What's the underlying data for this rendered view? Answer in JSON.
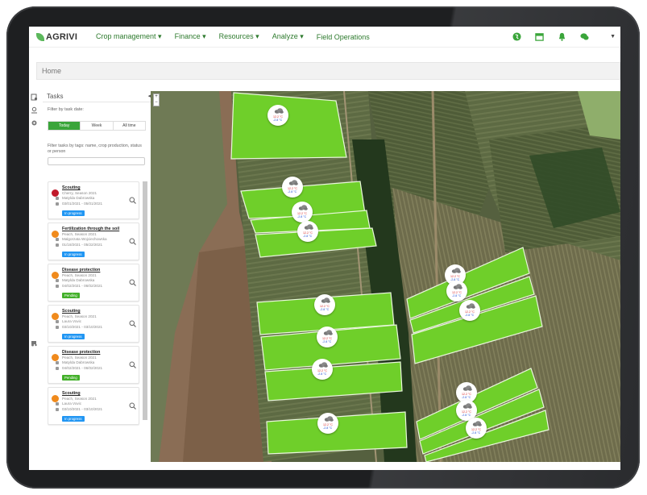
{
  "nav": {
    "logo": "AGRIVI",
    "items": [
      "Crop management",
      "Finance",
      "Resources",
      "Analyze",
      "Field Operations"
    ],
    "icons": [
      "globe-icon",
      "calendar-icon",
      "bell-icon",
      "chat-icon"
    ],
    "accent": "#2d7a2d"
  },
  "breadcrumb": {
    "home": "Home"
  },
  "tasks": {
    "title": "Tasks",
    "filter_date_label": "Filter by task date:",
    "segments": [
      "Today",
      "Week",
      "All time"
    ],
    "filter_tags_label": "Filter tasks by tags: name, crop production, status or person",
    "items": [
      {
        "title": "Scouting",
        "crop": "Cherry, Season 2021",
        "person": "Matylda Dabrowska",
        "dates": "03/01/2021 - 05/01/2021",
        "status": "In progress",
        "status_color": "#2196f3",
        "fruit_color": "#c0192a"
      },
      {
        "title": "Fertilization through the soil",
        "crop": "Peach, Season 2021",
        "person": "Malgorzata Wojciechowska",
        "dates": "01/18/2021 - 05/22/2021",
        "status": "In progress",
        "status_color": "#2196f3",
        "fruit_color": "#f08a1c"
      },
      {
        "title": "Disease protection",
        "crop": "Peach, Season 2021",
        "person": "Matylda Dabrowska",
        "dates": "04/02/2021 - 06/02/2021",
        "status": "Pending",
        "status_color": "#43b02a",
        "fruit_color": "#f08a1c"
      },
      {
        "title": "Scouting",
        "crop": "Peach, Season 2021",
        "person": "Laura Vovic",
        "dates": "03/10/2021 - 03/10/2021",
        "status": "In progress",
        "status_color": "#2196f3",
        "fruit_color": "#f08a1c"
      },
      {
        "title": "Disease protection",
        "crop": "Peach, Season 2021",
        "person": "Matylda Dabrowska",
        "dates": "04/02/2021 - 06/02/2021",
        "status": "Pending",
        "status_color": "#43b02a",
        "fruit_color": "#f08a1c"
      },
      {
        "title": "Scouting",
        "crop": "Peach, Season 2021",
        "person": "Laura Vovic",
        "dates": "03/10/2021 - 03/10/2021",
        "status": "In progress",
        "status_color": "#2196f3",
        "fruit_color": "#f08a1c"
      }
    ]
  },
  "map": {
    "zoom_in": "+",
    "zoom_out": "−",
    "field_color": "#6fcf2a",
    "weather": {
      "high": "12.2 °C",
      "low": "-2.8 °C"
    }
  }
}
